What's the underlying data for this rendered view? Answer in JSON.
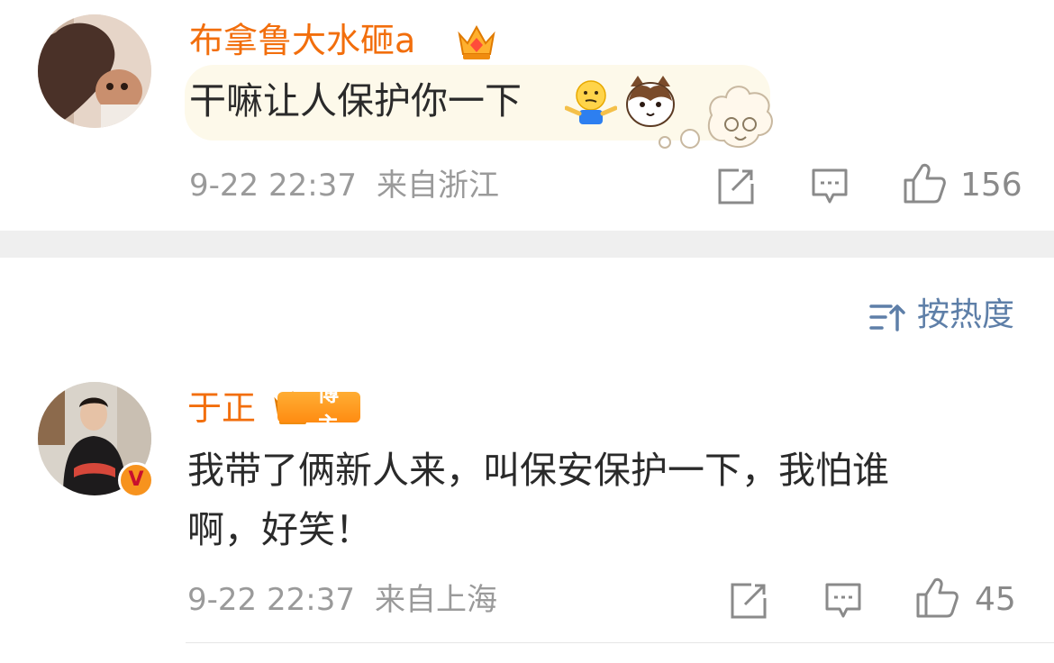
{
  "comments": [
    {
      "username": "布拿鲁大水砸a",
      "text": "干嘛让人保护你一下",
      "time": "9-22 22:37",
      "location": "来自浙江",
      "likes": "156",
      "badge_icon": "crown-badge-icon",
      "emojis": [
        "shrug-emoji",
        "cat-face-emoji"
      ]
    },
    {
      "username": "于正",
      "badge_label": "博主",
      "text_line1": "我带了俩新人来，叫保安保护一下，我怕谁",
      "text_line2": "啊，好笑！",
      "time": "9-22 22:37",
      "location": "来自上海",
      "likes": "45",
      "verified": "V"
    }
  ],
  "sort": {
    "label": "按热度"
  },
  "colors": {
    "username": "#f26e0c",
    "meta": "#9a9a9a",
    "sort": "#5e7fa8",
    "divider": "#efefef",
    "badge": "#ff8c12"
  }
}
